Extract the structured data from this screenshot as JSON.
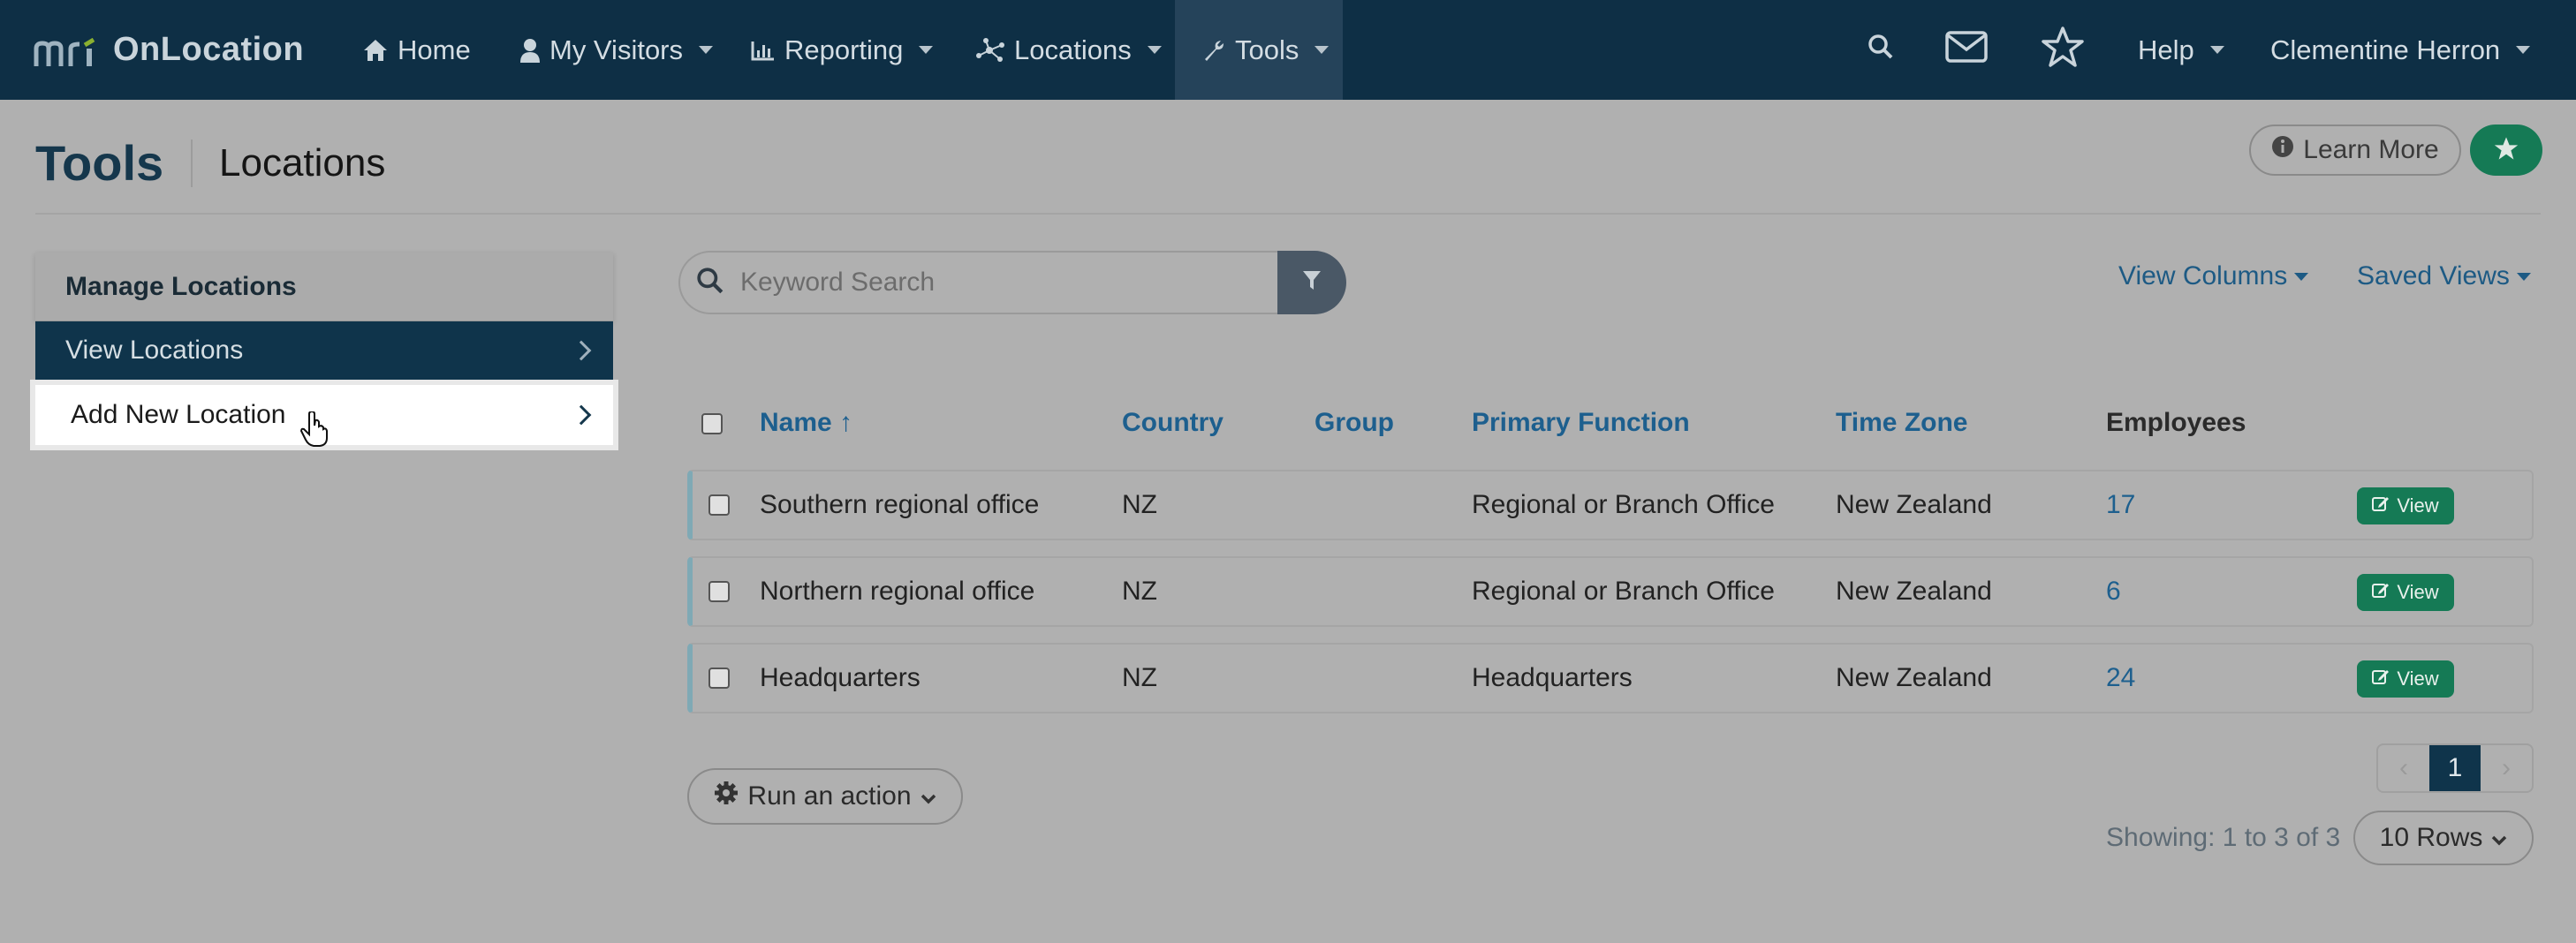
{
  "navbar": {
    "brand": "OnLocation",
    "items": [
      {
        "label": "Home",
        "icon": "home-icon"
      },
      {
        "label": "My Visitors",
        "icon": "user-icon"
      },
      {
        "label": "Reporting",
        "icon": "bar-chart-icon"
      },
      {
        "label": "Locations",
        "icon": "network-icon"
      },
      {
        "label": "Tools",
        "icon": "wrench-icon"
      }
    ],
    "help": "Help",
    "user": "Clementine Herron"
  },
  "header": {
    "title": "Tools",
    "subtitle": "Locations",
    "learn_more": "Learn More"
  },
  "sidebar": {
    "heading": "Manage Locations",
    "items": [
      {
        "label": "View Locations"
      },
      {
        "label": "Add New Location"
      }
    ]
  },
  "search": {
    "placeholder": "Keyword Search"
  },
  "toolbar": {
    "view_columns": "View Columns",
    "saved_views": "Saved Views"
  },
  "table": {
    "columns": [
      "Name ↑",
      "Country",
      "Group",
      "Primary Function",
      "Time Zone",
      "Employees"
    ],
    "view_label": "View",
    "rows": [
      {
        "name": "Southern regional office",
        "country": "NZ",
        "group": "",
        "primary_function": "Regional or Branch Office",
        "time_zone": "New Zealand",
        "employees": "17"
      },
      {
        "name": "Northern regional office",
        "country": "NZ",
        "group": "",
        "primary_function": "Regional or Branch Office",
        "time_zone": "New Zealand",
        "employees": "6"
      },
      {
        "name": "Headquarters",
        "country": "NZ",
        "group": "",
        "primary_function": "Headquarters",
        "time_zone": "New Zealand",
        "employees": "24"
      }
    ]
  },
  "footer": {
    "run_action": "Run an action",
    "current_page": "1",
    "prev": "‹",
    "next": "›",
    "showing": "Showing: 1 to 3 of 3",
    "rows_per_page": "10 Rows"
  },
  "colors": {
    "navbar": "#0e2f45",
    "accent_green": "#157a55",
    "link_blue": "#1d5f8e"
  }
}
